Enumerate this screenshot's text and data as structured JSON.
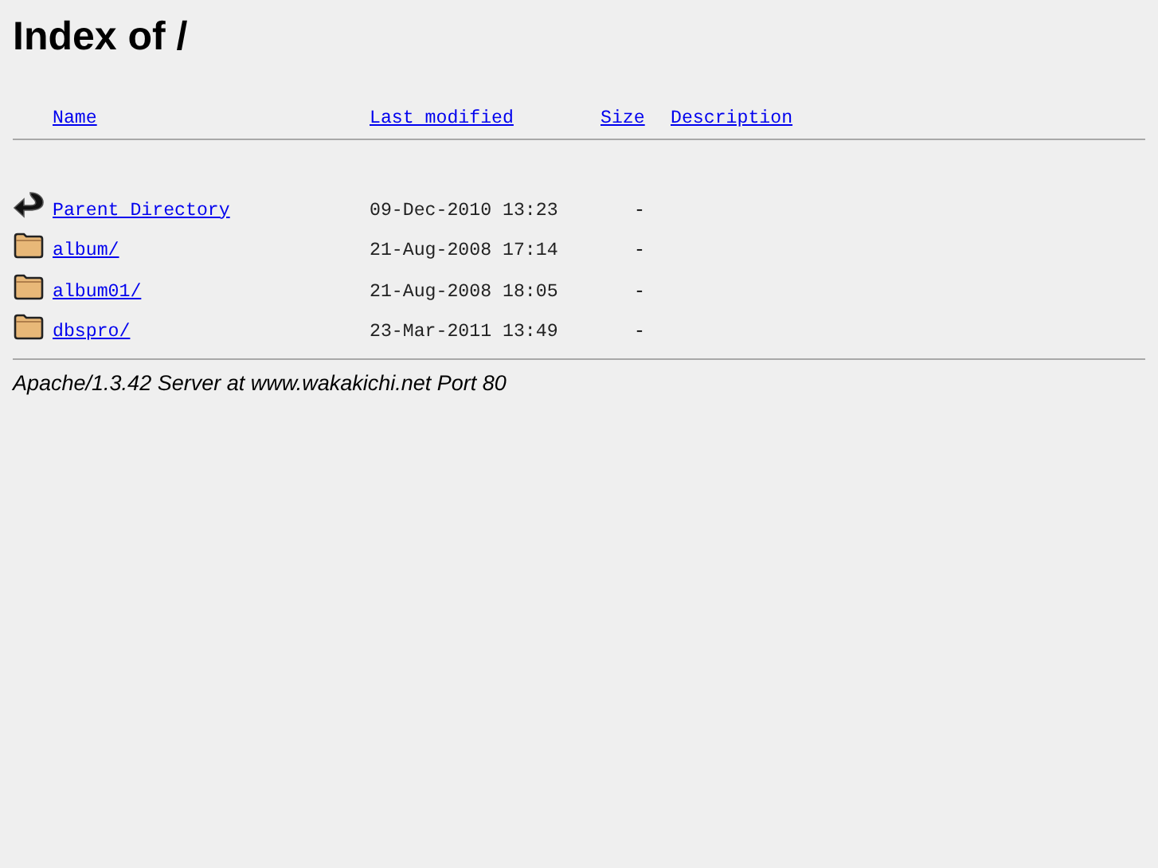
{
  "title": "Index of /",
  "columns": [
    {
      "label": "Name",
      "kind": "name"
    },
    {
      "label": "Last modified",
      "kind": "modified"
    },
    {
      "label": "Size",
      "kind": "size"
    },
    {
      "label": "Description",
      "kind": "description"
    }
  ],
  "rows": [
    {
      "kind": "parent",
      "name": "Parent Directory",
      "modified": "09-Dec-2010 13:23",
      "size": "-"
    },
    {
      "kind": "folder",
      "name": "album/",
      "modified": "21-Aug-2008 17:14",
      "size": "-"
    },
    {
      "kind": "folder",
      "name": "album01/",
      "modified": "21-Aug-2008 18:05",
      "size": "-"
    },
    {
      "kind": "folder",
      "name": "dbspro/",
      "modified": "23-Mar-2011 13:49",
      "size": "-"
    }
  ],
  "address": "Apache/1.3.42 Server at www.wakakichi.net Port 80"
}
